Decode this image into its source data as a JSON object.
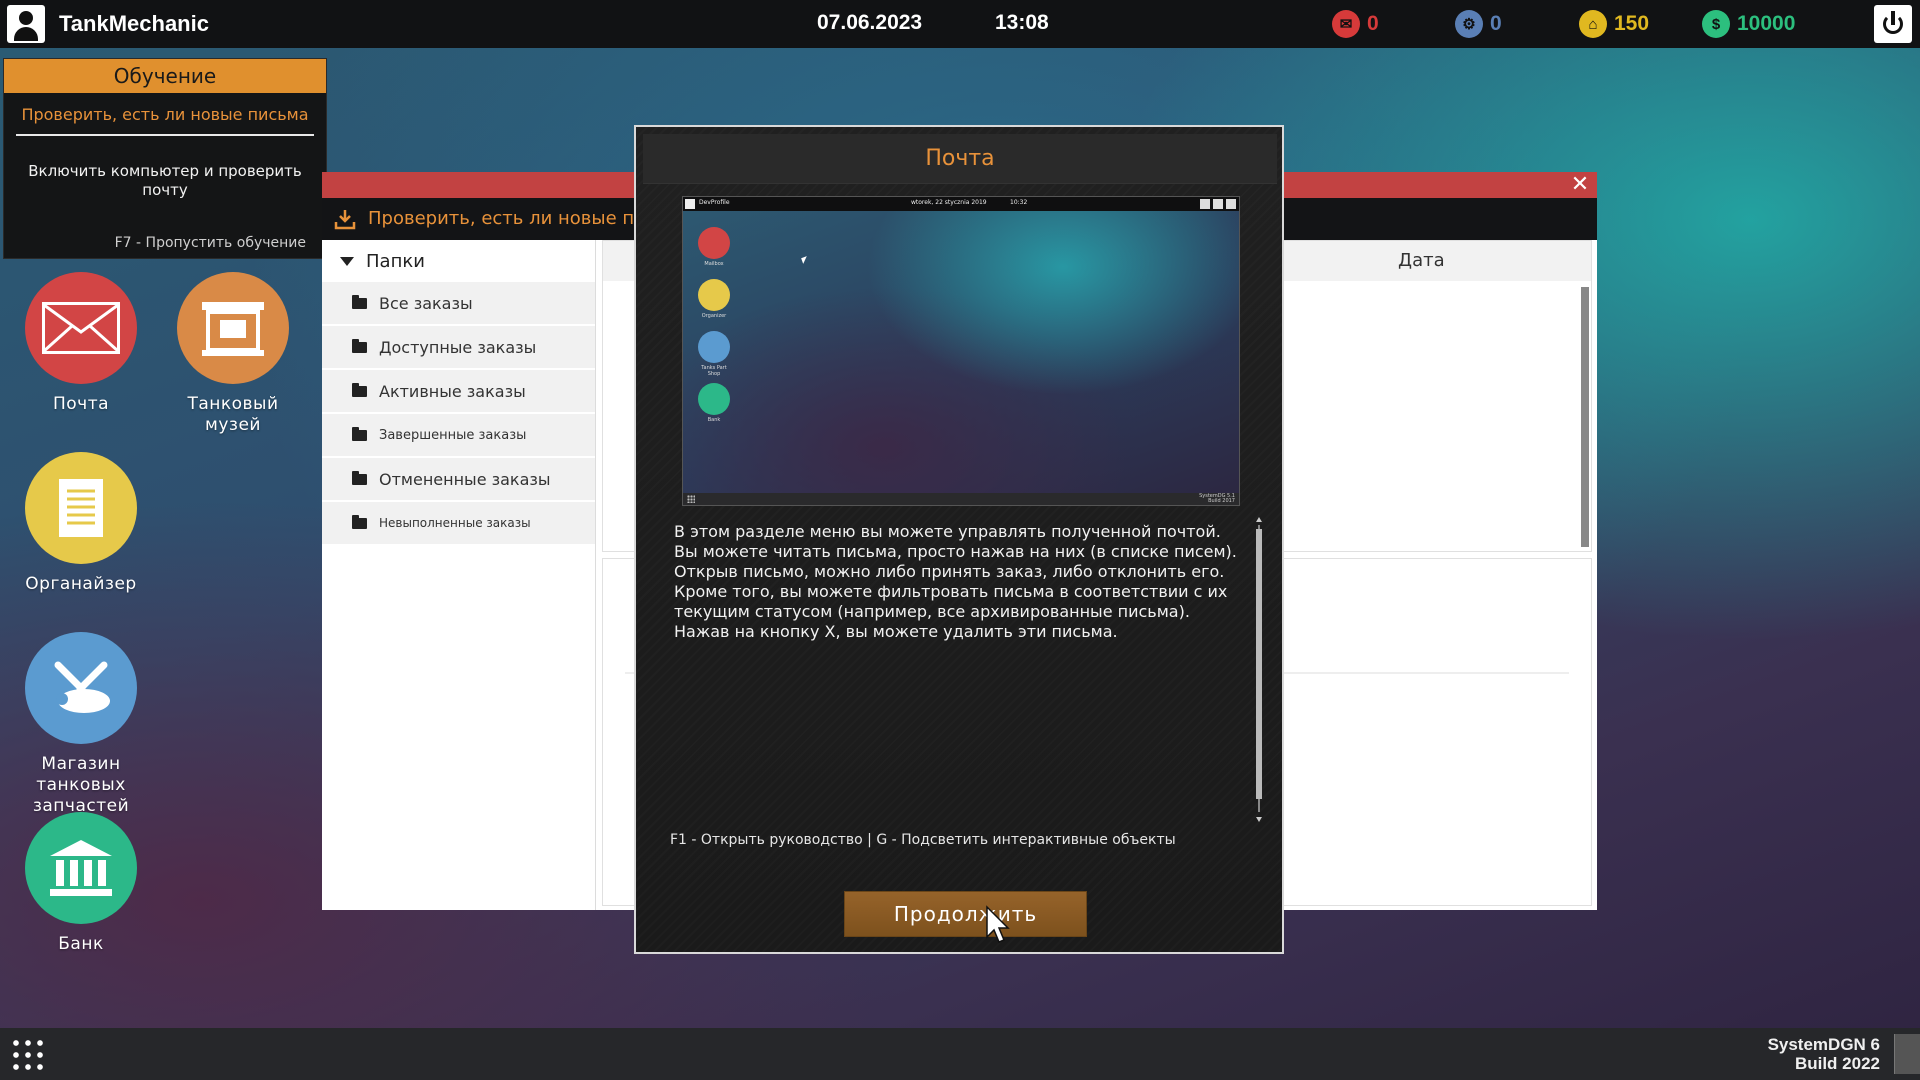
{
  "topbar": {
    "app_title": "TankMechanic",
    "date": "07.06.2023",
    "time": "13:08",
    "stats": {
      "mail": "0",
      "parts": "0",
      "points": "150",
      "money": "10000"
    },
    "colors": {
      "mail": "#d63a3a",
      "parts": "#5a7fb5",
      "points": "#e0b820",
      "money": "#2cbf7e"
    }
  },
  "tutorial": {
    "header": "Обучение",
    "task": "Проверить, есть ли новые письма",
    "description": "Включить компьютер и проверить почту",
    "skip": "F7 - Пропустить обучение"
  },
  "desktop": {
    "icons": [
      {
        "label": "Почта",
        "icon": "envelope-icon",
        "color": "#d24545"
      },
      {
        "label": "Танковый музей",
        "icon": "museum-icon",
        "color": "#d98a47"
      },
      {
        "label": "Органайзер",
        "icon": "notepad-icon",
        "color": "#e6c94a"
      },
      {
        "label": "Магазин танковых запчастей",
        "icon": "tank-parts-icon",
        "color": "#5b9bd0"
      },
      {
        "label": "Банк",
        "icon": "bank-icon",
        "color": "#2cb889"
      }
    ]
  },
  "mail_window": {
    "toolbar_title": "Проверить, есть ли новые письма",
    "folders_header": "Папки",
    "folders": [
      "Все заказы",
      "Доступные заказы",
      "Активные заказы",
      "Завершенные заказы",
      "Отмененные заказы",
      "Невыполненные заказы"
    ],
    "column_date": "Дата"
  },
  "modal": {
    "title": "Почта",
    "preview": {
      "user": "DevProfile",
      "date": "wtorek, 22 stycznia 2019",
      "time": "10:32",
      "icons": [
        "Mailbox",
        "Organizer",
        "Tanks Part Shop",
        "Bank"
      ],
      "system": "SystemDG 5.1",
      "build": "Build 2017"
    },
    "text_lines": [
      "В этом разделе меню вы можете управлять полученной почтой.",
      "Вы можете читать письма, просто нажав на них (в списке писем).",
      "Открыв письмо, можно либо принять заказ, либо отклонить его.",
      "Кроме того, вы можете фильтровать письма в соответствии с их",
      "текущим статусом (например, все архивированные письма).",
      "Нажав на кнопку X, вы можете удалить эти письма."
    ],
    "hint": "F1 - Открыть руководство | G - Подсветить интерактивные объекты",
    "button": "Продолжить"
  },
  "taskbar": {
    "system": "SystemDGN 6",
    "build": "Build 2022"
  }
}
